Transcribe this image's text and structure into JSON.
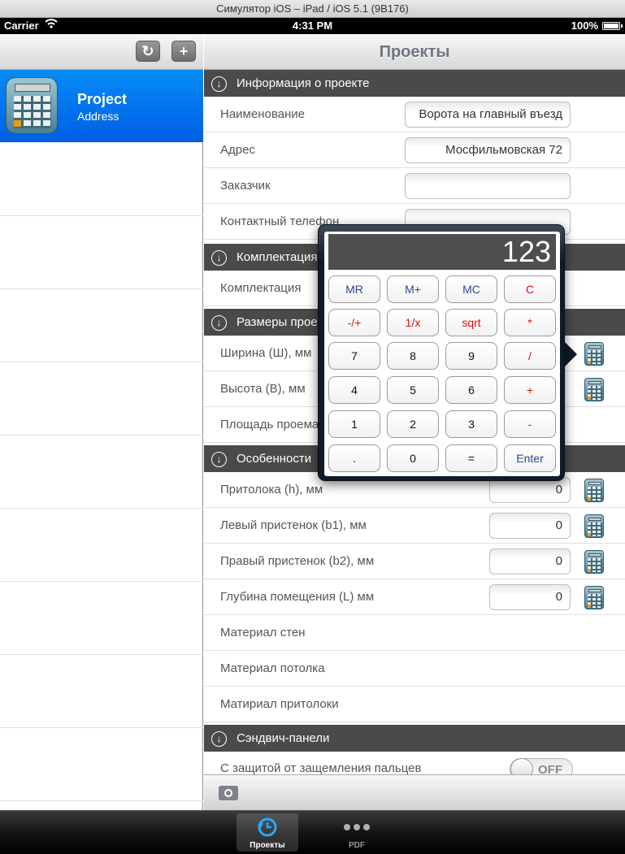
{
  "simulator": {
    "title": "Симулятор iOS – iPad / iOS 5.1 (9B176)"
  },
  "status_bar": {
    "carrier": "Carrier",
    "wifi_icon": "wifi-icon",
    "time": "4:31 PM",
    "battery": "100%"
  },
  "master": {
    "buttons": {
      "refresh_icon": "↻",
      "add_icon": "+"
    },
    "selected_project": {
      "title": "Project",
      "subtitle": "Address"
    }
  },
  "detail": {
    "title": "Проекты",
    "sections": {
      "info": "Информация о проекте",
      "kit": "Комплектация",
      "sizes": "Размеры прое",
      "features": "Особенности",
      "sandwich": "Сэндвич-панели"
    },
    "rows": {
      "name": {
        "label": "Наименование",
        "value": "Ворота на главный въезд"
      },
      "address": {
        "label": "Адрес",
        "value": "Мосфильмовская 72"
      },
      "customer": {
        "label": "Заказчик",
        "value": ""
      },
      "phone": {
        "label": "Контактный телефон",
        "value": ""
      },
      "kit": {
        "label": "Комплектация"
      },
      "width": {
        "label": "Ширина (Ш), мм"
      },
      "height": {
        "label": "Высота (В), мм"
      },
      "area": {
        "label": "Площадь проема"
      },
      "lintel": {
        "label": "Притолока (h), мм",
        "value": "0"
      },
      "left_wall": {
        "label": "Левый пристенок (b1), мм",
        "value": "0"
      },
      "right_wall": {
        "label": "Правый пристенок (b2), мм",
        "value": "0"
      },
      "depth": {
        "label": "Глубина помещения (L) мм",
        "value": "0"
      },
      "wall_material": {
        "label": "Материал стен"
      },
      "ceiling_material": {
        "label": "Материал потолка"
      },
      "lintel_material": {
        "label": "Матириал притолоки"
      },
      "finger_protection": {
        "label": "С защитой от защемления пальцев",
        "toggle": "OFF"
      }
    }
  },
  "calculator": {
    "display": "123",
    "keys": {
      "mr": "MR",
      "mplus": "M+",
      "mc": "MC",
      "c": "C",
      "sign": "-/+",
      "recip": "1/x",
      "sqrt": "sqrt",
      "mul": "*",
      "k7": "7",
      "k8": "8",
      "k9": "9",
      "div": "/",
      "k4": "4",
      "k5": "5",
      "k6": "6",
      "plus": "+",
      "k1": "1",
      "k2": "2",
      "k3": "3",
      "minus": "-",
      "dot": ".",
      "k0": "0",
      "eq": "=",
      "enter": "Enter"
    }
  },
  "tabbar": {
    "projects": {
      "label": "Проекты",
      "icon": "clock-sync-icon"
    },
    "pdf": {
      "label": "PDF",
      "icon": "more-dots-icon"
    }
  },
  "colors": {
    "selection_blue": "#0a7af0",
    "section_header": "#4a4a4a",
    "operator_red": "#e01010",
    "memory_blue": "#2c4a8a"
  }
}
